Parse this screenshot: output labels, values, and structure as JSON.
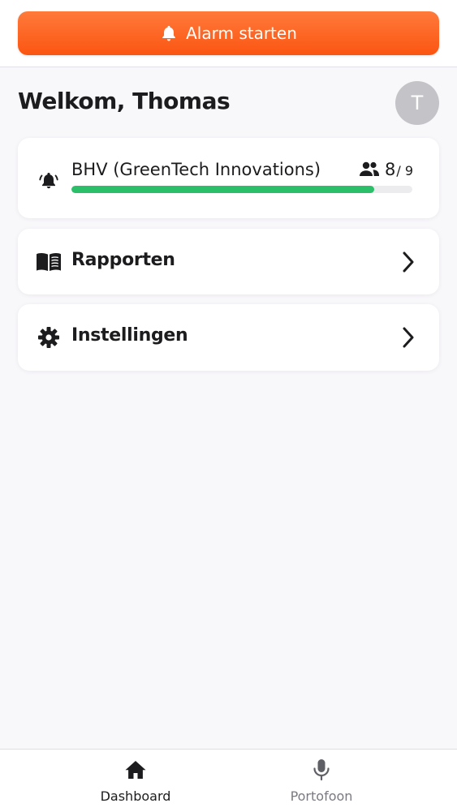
{
  "header": {
    "alarm_label": "Alarm starten"
  },
  "greeting": {
    "title": "Welkom, Thomas",
    "avatar_initial": "T"
  },
  "team_card": {
    "name": "BHV (GreenTech Innovations)",
    "current": "8",
    "total": "/ 9",
    "progress": 0.889
  },
  "menu": {
    "reports_label": "Rapporten",
    "settings_label": "Instellingen"
  },
  "bottom_nav": {
    "dashboard_label": "Dashboard",
    "portofoon_label": "Portofoon"
  },
  "colors": {
    "accent": "#fb5512",
    "progress": "#2cbf6a"
  },
  "icons": {
    "alarm": "bell-icon",
    "team": "bell-ringing-icon",
    "people": "people-icon",
    "reports": "book-open-icon",
    "settings": "gear-icon",
    "chevron": "chevron-right-icon",
    "dashboard": "home-icon",
    "portofoon": "microphone-icon"
  }
}
